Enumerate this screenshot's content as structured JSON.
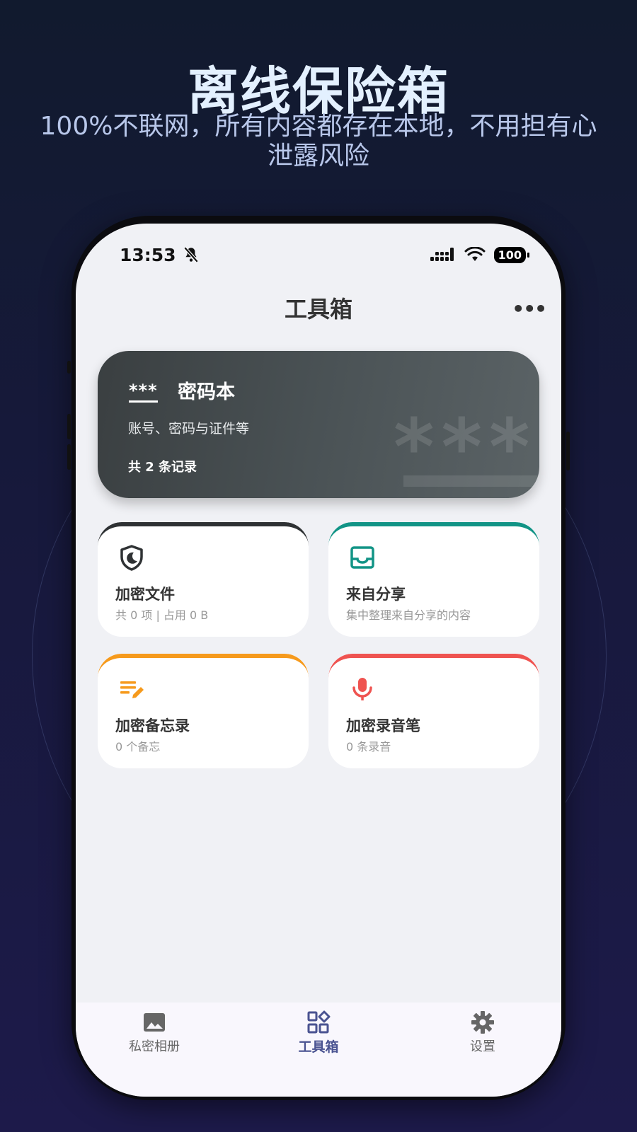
{
  "hero": {
    "title": "离线保险箱",
    "subtitle": "100%不联网，所有内容都存在本地，不用担有心泄露风险"
  },
  "status_bar": {
    "time": "13:53",
    "battery": "100",
    "icons": [
      "bell-off-icon",
      "signal-icon",
      "wifi-icon",
      "battery-icon"
    ]
  },
  "appbar": {
    "title": "工具箱",
    "more": "•••"
  },
  "password_card": {
    "stars": "***",
    "title": "密码本",
    "description": "账号、密码与证件等",
    "count": "共 2 条记录",
    "watermark": "***"
  },
  "tiles": [
    {
      "title": "加密文件",
      "subtitle": "共 0 项 | 占用 0 B",
      "accent": "#2f3234",
      "icon": "shield-moon-icon"
    },
    {
      "title": "来自分享",
      "subtitle": "集中整理来自分享的内容",
      "accent": "#129486",
      "icon": "inbox-icon"
    },
    {
      "title": "加密备忘录",
      "subtitle": "0 个备忘",
      "accent": "#f69a1c",
      "icon": "notes-edit-icon"
    },
    {
      "title": "加密录音笔",
      "subtitle": "0 条录音",
      "accent": "#ef5350",
      "icon": "microphone-icon"
    }
  ],
  "bottom_nav": {
    "items": [
      {
        "label": "私密相册",
        "icon": "image-icon",
        "active": false
      },
      {
        "label": "工具箱",
        "icon": "grid-shapes-icon",
        "active": true
      },
      {
        "label": "设置",
        "icon": "gear-icon",
        "active": false
      }
    ]
  },
  "colors": {
    "background": "#17193c",
    "hero_title": "#e3f0ff",
    "active_nav": "#4a5391"
  }
}
